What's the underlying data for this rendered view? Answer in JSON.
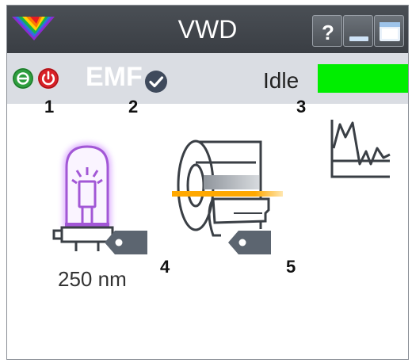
{
  "window": {
    "title": "VWD",
    "logo_icon": "agilent-spark-logo-icon",
    "buttons": {
      "help_label": "?",
      "minimize_icon": "minimize-icon",
      "maximize_icon": "maximize-icon"
    }
  },
  "status": {
    "on_button_icon": "power-on-icon",
    "off_button_icon": "power-off-icon",
    "emf_label": "EMF",
    "emf_check_icon": "check-circle-icon",
    "state_label": "Idle",
    "state_color": "#00ee00"
  },
  "callouts": [
    "1",
    "2",
    "3",
    "4",
    "5"
  ],
  "lamp": {
    "icon": "lamp-icon",
    "wavelength_label": "250 nm",
    "tag_icon": "tag-icon"
  },
  "flow_cell": {
    "icon": "flow-cell-icon",
    "tag_icon": "tag-icon"
  },
  "signal": {
    "icon": "signal-plot-icon"
  },
  "colors": {
    "titlebar": "#3f444a",
    "statusbar": "#dadde3",
    "on_green": "#2e9e3e",
    "off_red": "#d92027",
    "lamp_purple": "#a257d6",
    "beam_orange": "#ffb000",
    "icon_gray": "#5c6570"
  }
}
